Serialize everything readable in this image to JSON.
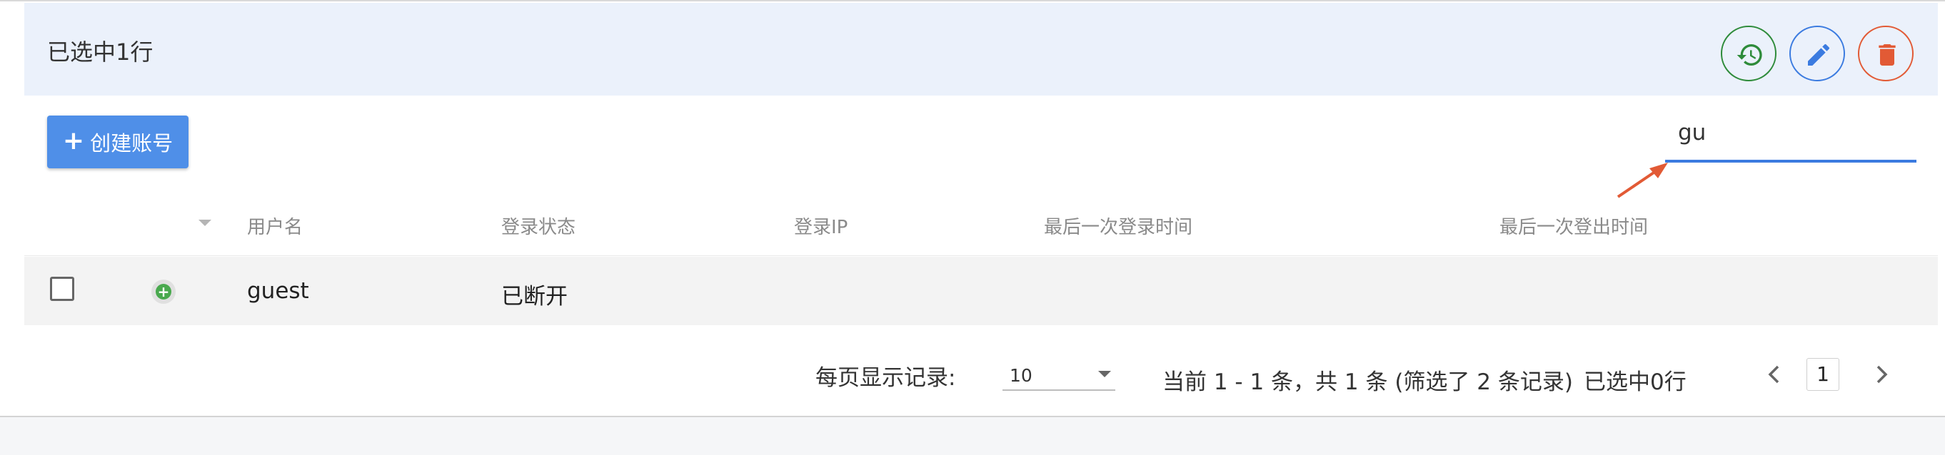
{
  "selection_bar": {
    "text": "已选中1行",
    "actions": [
      {
        "icon": "history-icon",
        "color": "#2e8b3a"
      },
      {
        "icon": "pencil-icon",
        "color": "#3b7be0"
      },
      {
        "icon": "trash-icon",
        "color": "#e25a35"
      }
    ]
  },
  "toolbar": {
    "create_button_icon": "+",
    "create_button_label": "创建账号"
  },
  "search": {
    "value": "gu"
  },
  "table": {
    "columns": [
      "用户名",
      "登录状态",
      "登录IP",
      "最后一次登录时间",
      "最后一次登出时间"
    ],
    "rows": [
      {
        "checked": false,
        "status_icon": "+",
        "username": "guest",
        "login_status": "已断开",
        "login_ip": "",
        "last_login": "",
        "last_logout": ""
      }
    ]
  },
  "footer": {
    "page_size_label": "每页显示记录:",
    "page_size": "10",
    "range_text": "当前 1 - 1 条，共 1 条 (筛选了 2 条记录)",
    "selected_text": "已选中0行",
    "current_page": "1"
  },
  "colors": {
    "accent": "#4f8fe8",
    "selection_bg": "#ebf1fb",
    "annotation_arrow": "#e25a35"
  }
}
